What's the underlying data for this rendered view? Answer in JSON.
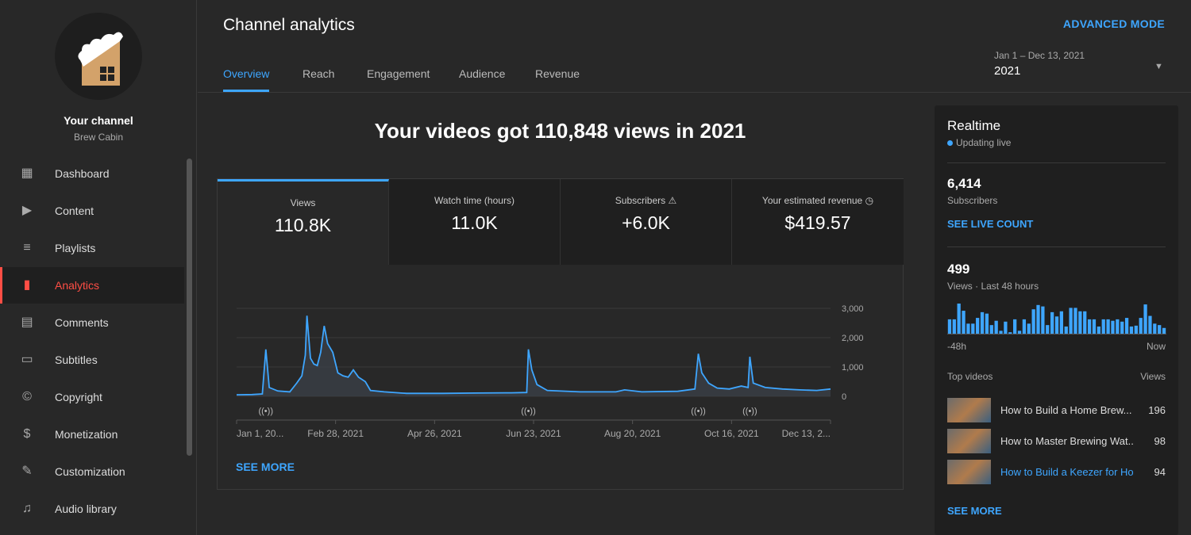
{
  "sidebar": {
    "title": "Your channel",
    "channel": "Brew Cabin",
    "items": [
      {
        "label": "Dashboard",
        "icon": "dashboard-icon"
      },
      {
        "label": "Content",
        "icon": "content-icon"
      },
      {
        "label": "Playlists",
        "icon": "playlists-icon"
      },
      {
        "label": "Analytics",
        "icon": "analytics-icon",
        "active": true
      },
      {
        "label": "Comments",
        "icon": "comments-icon"
      },
      {
        "label": "Subtitles",
        "icon": "subtitles-icon"
      },
      {
        "label": "Copyright",
        "icon": "copyright-icon"
      },
      {
        "label": "Monetization",
        "icon": "dollar-icon"
      },
      {
        "label": "Customization",
        "icon": "wand-icon"
      },
      {
        "label": "Audio library",
        "icon": "audio-library-icon"
      }
    ]
  },
  "header": {
    "title": "Channel analytics",
    "advanced": "ADVANCED MODE",
    "tabs": [
      "Overview",
      "Reach",
      "Engagement",
      "Audience",
      "Revenue"
    ],
    "active_tab": "Overview",
    "range_sub": "Jan 1 – Dec 13, 2021",
    "range": "2021"
  },
  "main": {
    "headline": "Your videos got 110,848 views in 2021",
    "metrics": [
      {
        "label": "Views",
        "value": "110.8K"
      },
      {
        "label": "Watch time (hours)",
        "value": "11.0K"
      },
      {
        "label": "Subscribers",
        "value": "+6.0K",
        "icon": "warning-icon"
      },
      {
        "label": "Your estimated revenue",
        "value": "$419.57",
        "icon": "clock-icon"
      }
    ],
    "see_more": "SEE MORE"
  },
  "chart_data": {
    "type": "area",
    "ylim": [
      0,
      3000
    ],
    "yticks": [
      "0",
      "1,000",
      "2,000",
      "3,000"
    ],
    "xticks": [
      "Jan 1, 20...",
      "Feb 28, 2021",
      "Apr 26, 2021",
      "Jun 23, 2021",
      "Aug 20, 2021",
      "Oct 16, 2021",
      "Dec 13, 2..."
    ],
    "color": "#3ea6ff",
    "grid": true,
    "points": [
      [
        "2021-01-01",
        50
      ],
      [
        "2021-01-10",
        60
      ],
      [
        "2021-01-16",
        80
      ],
      [
        "2021-01-18",
        1600
      ],
      [
        "2021-01-20",
        300
      ],
      [
        "2021-01-25",
        180
      ],
      [
        "2021-02-01",
        150
      ],
      [
        "2021-02-05",
        450
      ],
      [
        "2021-02-08",
        700
      ],
      [
        "2021-02-10",
        1400
      ],
      [
        "2021-02-11",
        2750
      ],
      [
        "2021-02-13",
        1300
      ],
      [
        "2021-02-15",
        1100
      ],
      [
        "2021-02-17",
        1050
      ],
      [
        "2021-02-19",
        1500
      ],
      [
        "2021-02-21",
        2400
      ],
      [
        "2021-02-23",
        1800
      ],
      [
        "2021-02-26",
        1500
      ],
      [
        "2021-03-01",
        800
      ],
      [
        "2021-03-04",
        700
      ],
      [
        "2021-03-07",
        650
      ],
      [
        "2021-03-10",
        900
      ],
      [
        "2021-03-13",
        650
      ],
      [
        "2021-03-17",
        500
      ],
      [
        "2021-03-20",
        200
      ],
      [
        "2021-03-28",
        150
      ],
      [
        "2021-04-10",
        100
      ],
      [
        "2021-05-01",
        100
      ],
      [
        "2021-05-20",
        110
      ],
      [
        "2021-06-10",
        120
      ],
      [
        "2021-06-19",
        130
      ],
      [
        "2021-06-20",
        1600
      ],
      [
        "2021-06-22",
        900
      ],
      [
        "2021-06-25",
        400
      ],
      [
        "2021-07-01",
        200
      ],
      [
        "2021-07-20",
        150
      ],
      [
        "2021-08-10",
        150
      ],
      [
        "2021-08-15",
        220
      ],
      [
        "2021-08-25",
        150
      ],
      [
        "2021-09-15",
        170
      ],
      [
        "2021-09-25",
        250
      ],
      [
        "2021-09-27",
        1450
      ],
      [
        "2021-09-29",
        800
      ],
      [
        "2021-10-03",
        450
      ],
      [
        "2021-10-08",
        280
      ],
      [
        "2021-10-15",
        250
      ],
      [
        "2021-10-22",
        350
      ],
      [
        "2021-10-26",
        300
      ],
      [
        "2021-10-27",
        1350
      ],
      [
        "2021-10-29",
        450
      ],
      [
        "2021-11-05",
        300
      ],
      [
        "2021-11-15",
        250
      ],
      [
        "2021-11-25",
        220
      ],
      [
        "2021-12-05",
        200
      ],
      [
        "2021-12-13",
        250
      ]
    ],
    "live_markers": [
      "2021-01-18",
      "2021-06-20",
      "2021-09-27",
      "2021-10-27"
    ]
  },
  "realtime": {
    "title": "Realtime",
    "status": "Updating live",
    "subs": "6,414",
    "subs_label": "Subscribers",
    "see_live": "SEE LIVE COUNT",
    "views": "499",
    "views_label": "Views · Last 48 hours",
    "axis_start": "-48h",
    "axis_end": "Now",
    "bars": [
      50,
      50,
      105,
      80,
      35,
      35,
      55,
      75,
      70,
      30,
      45,
      10,
      42,
      5,
      50,
      10,
      50,
      35,
      85,
      100,
      95,
      30,
      75,
      60,
      78,
      25,
      90,
      90,
      78,
      78,
      50,
      50,
      25,
      50,
      50,
      45,
      50,
      42,
      55,
      25,
      28,
      55,
      102,
      62,
      35,
      30,
      20
    ],
    "top_label": "Top videos",
    "views_col": "Views",
    "videos": [
      {
        "title": "How to Build a Home Brew...",
        "views": "196"
      },
      {
        "title": "How to Master Brewing Wat...",
        "views": "98"
      },
      {
        "title": "How to Build a Keezer for Ho...",
        "views": "94",
        "highlight": true
      }
    ],
    "see_more": "SEE MORE"
  }
}
